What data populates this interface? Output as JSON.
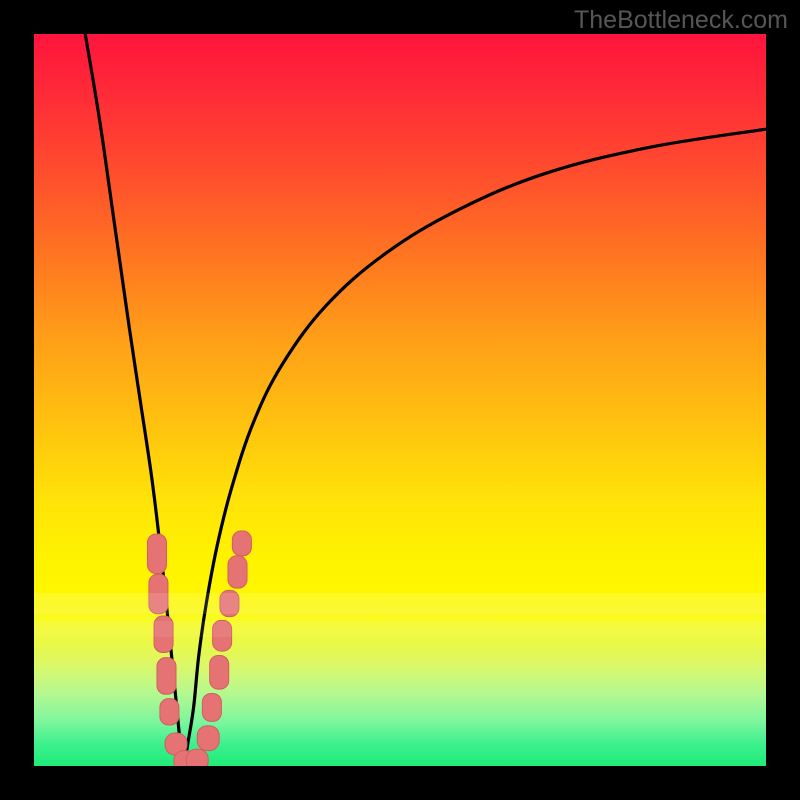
{
  "watermark": "TheBottleneck.com",
  "colors": {
    "page_bg": "#000000",
    "gradient_top": "#ff143c",
    "gradient_bottom": "#20eb78",
    "curve_stroke": "#000000",
    "marker_fill": "#e57373",
    "marker_stroke": "#cf5f5f"
  },
  "chart_data": {
    "type": "line",
    "title": "",
    "xlabel": "",
    "ylabel": "",
    "xlim": [
      0,
      100
    ],
    "ylim": [
      0,
      100
    ],
    "note": "Axes are not labeled in the image; values below are fractional positions (0–100) read off the plot area. The curve is a V-shaped bottleneck profile dipping to ~0 near x≈20.5 and rising sharply on both sides.",
    "series": [
      {
        "name": "bottleneck-curve",
        "x": [
          7,
          9,
          11,
          13,
          14.5,
          16,
          17,
          18,
          18.8,
          19.5,
          20,
          20.5,
          21,
          21.8,
          22.5,
          23.5,
          25,
          27,
          30,
          34,
          40,
          48,
          58,
          70,
          84,
          100
        ],
        "values": [
          100,
          88,
          74,
          60,
          50,
          40,
          32,
          23,
          15,
          8,
          3,
          0,
          3,
          8,
          15,
          22,
          30,
          38,
          47,
          55,
          63,
          70,
          76,
          81,
          84.5,
          87
        ]
      }
    ],
    "markers": {
      "name": "highlighted-points",
      "shape": "rounded-rect",
      "points": [
        {
          "x": 16.8,
          "y": 29,
          "w": 2.6,
          "h": 5.4
        },
        {
          "x": 17.0,
          "y": 23.5,
          "w": 2.6,
          "h": 5.4
        },
        {
          "x": 17.7,
          "y": 18.0,
          "w": 2.6,
          "h": 5.0
        },
        {
          "x": 18.1,
          "y": 12.3,
          "w": 2.6,
          "h": 5.0
        },
        {
          "x": 18.5,
          "y": 7.4,
          "w": 2.6,
          "h": 3.6
        },
        {
          "x": 19.4,
          "y": 3.0,
          "w": 3.0,
          "h": 3.0
        },
        {
          "x": 20.6,
          "y": 0.6,
          "w": 3.0,
          "h": 3.0
        },
        {
          "x": 22.3,
          "y": 0.8,
          "w": 3.0,
          "h": 3.0
        },
        {
          "x": 23.8,
          "y": 3.8,
          "w": 3.0,
          "h": 3.4
        },
        {
          "x": 24.3,
          "y": 8.0,
          "w": 2.6,
          "h": 3.8
        },
        {
          "x": 25.3,
          "y": 12.8,
          "w": 2.6,
          "h": 4.6
        },
        {
          "x": 25.7,
          "y": 17.8,
          "w": 2.6,
          "h": 4.2
        },
        {
          "x": 26.7,
          "y": 22.2,
          "w": 2.6,
          "h": 3.6
        },
        {
          "x": 27.8,
          "y": 26.5,
          "w": 2.6,
          "h": 4.4
        },
        {
          "x": 28.4,
          "y": 30.4,
          "w": 2.6,
          "h": 3.4
        }
      ]
    }
  }
}
